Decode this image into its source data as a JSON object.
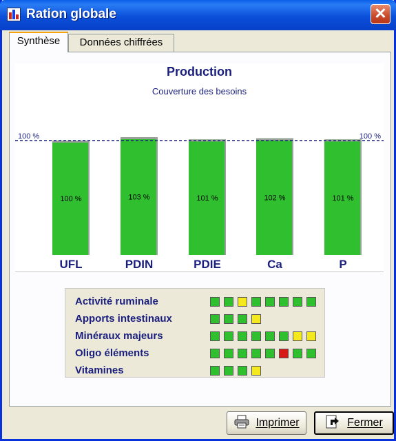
{
  "window": {
    "title": "Ration globale",
    "close_label": "✕"
  },
  "tabs": [
    {
      "label": "Synthèse",
      "active": true
    },
    {
      "label": "Données chiffrées",
      "active": false
    }
  ],
  "chart_data": {
    "type": "bar",
    "title": "Production",
    "subtitle": "Couverture des besoins",
    "categories": [
      "UFL",
      "PDIN",
      "PDIE",
      "Ca",
      "P"
    ],
    "values": [
      100,
      103,
      101,
      102,
      101
    ],
    "value_labels": [
      "100 %",
      "103 %",
      "101 %",
      "102 %",
      "101 %"
    ],
    "reference_line": {
      "value": 100,
      "label": "100 %"
    },
    "ylim": [
      0,
      128
    ],
    "colors": {
      "bar": "#2fbf2f",
      "bar_top": "#9aa09a",
      "text": "#1a1f7e",
      "reference": "#1a1f7e"
    }
  },
  "indicators": [
    {
      "label": "Activité ruminale",
      "squares": [
        "green",
        "green",
        "yellow",
        "green",
        "green",
        "green",
        "green",
        "green"
      ]
    },
    {
      "label": "Apports intestinaux",
      "squares": [
        "green",
        "green",
        "green",
        "yellow"
      ]
    },
    {
      "label": "Minéraux majeurs",
      "squares": [
        "green",
        "green",
        "green",
        "green",
        "green",
        "green",
        "yellow",
        "yellow"
      ]
    },
    {
      "label": "Oligo éléments",
      "squares": [
        "green",
        "green",
        "green",
        "green",
        "green",
        "red",
        "green",
        "green"
      ]
    },
    {
      "label": "Vitamines",
      "squares": [
        "green",
        "green",
        "green",
        "yellow"
      ]
    }
  ],
  "buttons": {
    "print": {
      "label": "Imprimer",
      "icon": "printer-icon"
    },
    "close": {
      "label": "Fermer",
      "icon": "exit-arrow-icon"
    }
  }
}
